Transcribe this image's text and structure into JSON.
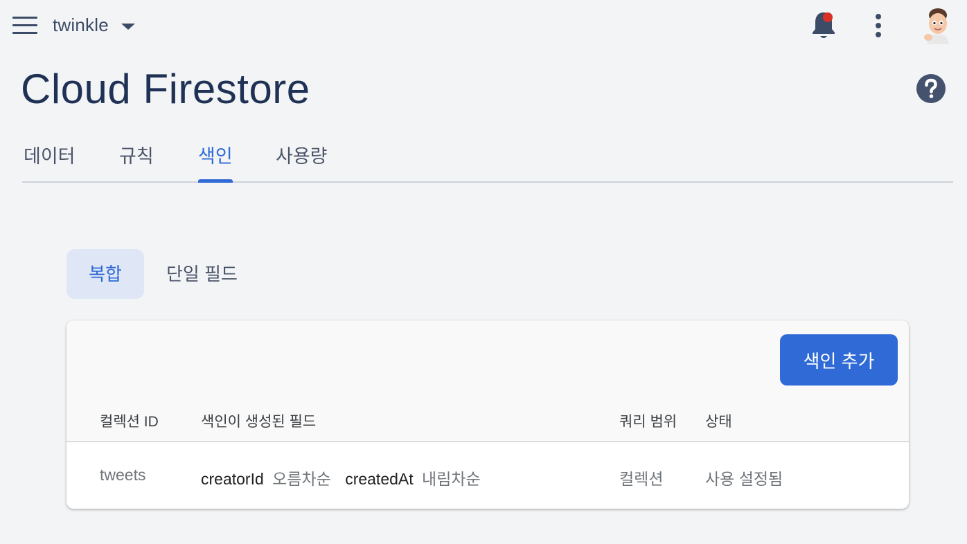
{
  "header": {
    "project_name": "twinkle",
    "icons": [
      "menu-icon",
      "chevron-down-icon",
      "notifications-bell-icon",
      "more-vert-icon",
      "avatar"
    ],
    "notification_dot_color": "#d93025"
  },
  "page": {
    "title": "Cloud Firestore",
    "help_icon": "help-icon"
  },
  "tabs": [
    {
      "label": "데이터",
      "active": false
    },
    {
      "label": "규칙",
      "active": false
    },
    {
      "label": "색인",
      "active": true
    },
    {
      "label": "사용량",
      "active": false
    }
  ],
  "subtabs": [
    {
      "label": "복합",
      "active": true
    },
    {
      "label": "단일 필드",
      "active": false
    }
  ],
  "card": {
    "add_button_label": "색인 추가",
    "columns": [
      "컬렉션 ID",
      "색인이 생성된 필드",
      "쿼리 범위",
      "상태"
    ],
    "rows": [
      {
        "collection_id": "tweets",
        "fields": [
          {
            "name": "creatorId",
            "order": "오름차순"
          },
          {
            "name": "createdAt",
            "order": "내림차순"
          }
        ],
        "query_scope": "컬렉션",
        "status": "사용 설정됨"
      }
    ]
  },
  "colors": {
    "accent": "#2f6ad6",
    "title": "#1f3255",
    "background": "#f3f4f6"
  }
}
